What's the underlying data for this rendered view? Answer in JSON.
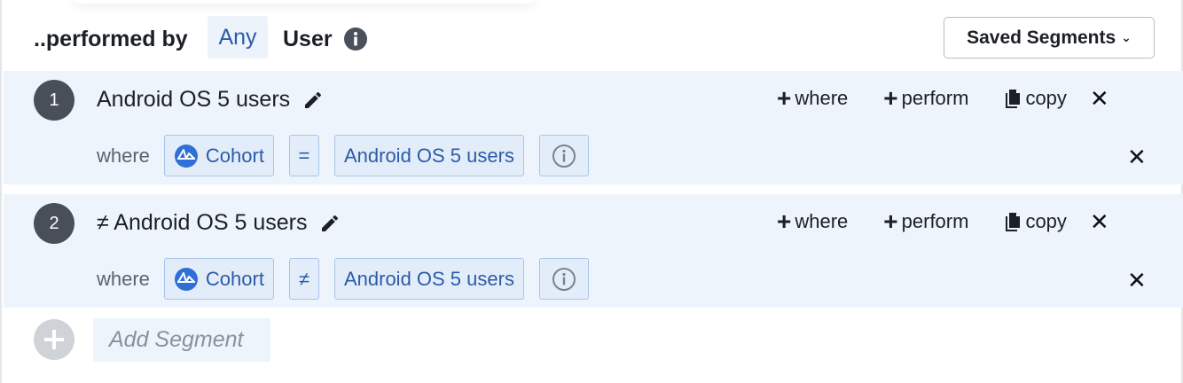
{
  "header": {
    "performed_label": "..performed by",
    "any_label": "Any",
    "user_label": "User",
    "saved_segments_label": "Saved Segments",
    "saved_segments_chevron": "⌄"
  },
  "segments": [
    {
      "number": "1",
      "title": "Android OS 5 users",
      "actions": {
        "where": "where",
        "perform": "perform",
        "copy": "copy"
      },
      "where_label": "where",
      "property": "Cohort",
      "operator": "=",
      "value": "Android OS 5 users"
    },
    {
      "number": "2",
      "title": "≠ Android OS 5 users",
      "actions": {
        "where": "where",
        "perform": "perform",
        "copy": "copy"
      },
      "where_label": "where",
      "property": "Cohort",
      "operator": "≠",
      "value": "Android OS 5 users"
    }
  ],
  "add_segment": {
    "placeholder": "Add Segment"
  },
  "colors": {
    "accent": "#2b5ba8",
    "segment_bg": "#eef4fc",
    "chip_bg": "#e3edfa",
    "chip_border": "#a9c4ea",
    "badge": "#484f59"
  },
  "icons": [
    "info-icon",
    "chevron-down-icon",
    "pencil-icon",
    "plus-icon",
    "copy-icon",
    "close-icon",
    "cohort-icon",
    "add-segment-icon"
  ]
}
